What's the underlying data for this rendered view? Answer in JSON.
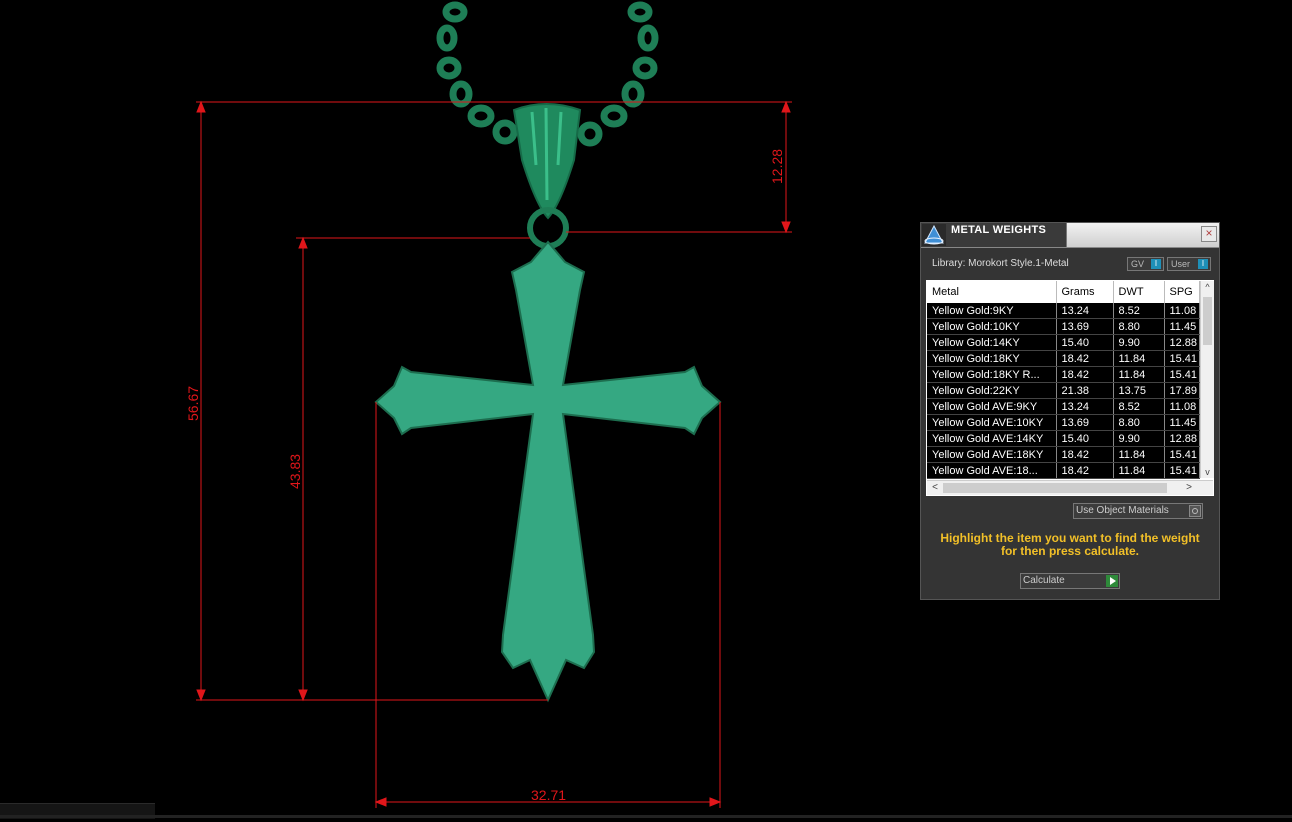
{
  "dimensions": {
    "top_height": "12.28",
    "overall_height": "56.67",
    "body_height": "43.83",
    "width": "32.71"
  },
  "colors": {
    "background": "#000000",
    "dimension_line": "#e0161a",
    "pendant": "#35a882",
    "chain": "#1e7e56"
  },
  "panel": {
    "title": "METAL WEIGHTS",
    "close_icon": "×",
    "library_label": "Library: Morokort Style.1-Metal",
    "toggle_gv": "GV",
    "toggle_user": "User",
    "toggle_knob": "I",
    "columns": [
      "Metal",
      "Grams",
      "DWT",
      "SPG"
    ],
    "rows": [
      [
        "Yellow Gold:9KY",
        "13.24",
        "8.52",
        "11.08"
      ],
      [
        "Yellow Gold:10KY",
        "13.69",
        "8.80",
        "11.45"
      ],
      [
        "Yellow Gold:14KY",
        "15.40",
        "9.90",
        "12.88"
      ],
      [
        "Yellow Gold:18KY",
        "18.42",
        "11.84",
        "15.41"
      ],
      [
        "Yellow Gold:18KY R...",
        "18.42",
        "11.84",
        "15.41"
      ],
      [
        "Yellow Gold:22KY",
        "21.38",
        "13.75",
        "17.89"
      ],
      [
        "Yellow Gold AVE:9KY",
        "13.24",
        "8.52",
        "11.08"
      ],
      [
        "Yellow Gold AVE:10KY",
        "13.69",
        "8.80",
        "11.45"
      ],
      [
        "Yellow Gold AVE:14KY",
        "15.40",
        "9.90",
        "12.88"
      ],
      [
        "Yellow Gold AVE:18KY",
        "18.42",
        "11.84",
        "15.41"
      ],
      [
        "Yellow Gold AVE:18...",
        "18.42",
        "11.84",
        "15.41"
      ]
    ],
    "scroll_up": "^",
    "scroll_down": "v",
    "scroll_left": "<",
    "scroll_right": ">",
    "use_object_materials": "Use Object Materials",
    "instruction": "Highlight the item you want to find the weight for then press calculate.",
    "calculate_label": "Calculate"
  }
}
